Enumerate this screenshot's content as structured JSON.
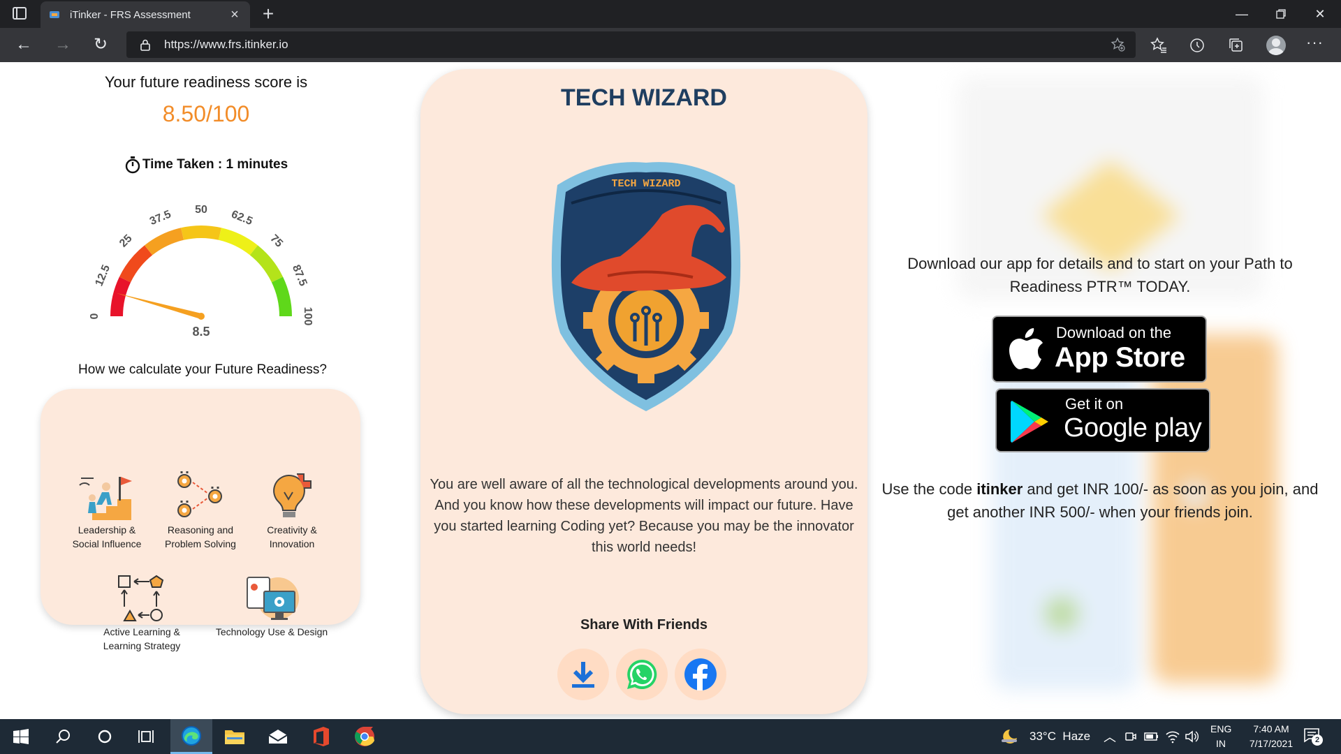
{
  "browser": {
    "tab_title": "iTinker - FRS Assessment",
    "url": "https://www.frs.itinker.io"
  },
  "score": {
    "title": "Your future readiness score is",
    "value": "8.50/100",
    "time_taken": "Time Taken : 1 minutes",
    "gauge_value": 8.5,
    "gauge_max": 100,
    "gauge_value_label": "8.5",
    "gauge_ticks": [
      "0",
      "12.5",
      "25",
      "37.5",
      "50",
      "62.5",
      "75",
      "87.5",
      "100"
    ]
  },
  "calc": {
    "title": "How we calculate your Future Readiness?",
    "skills": [
      {
        "label": "Leadership & Social Influence",
        "icon": "leadership-icon"
      },
      {
        "label": "Reasoning and Problem Solving",
        "icon": "gears-icon"
      },
      {
        "label": "Creativity & Innovation",
        "icon": "lightbulb-icon"
      },
      {
        "label": "Active Learning & Learning Strategy",
        "icon": "flowchart-icon"
      },
      {
        "label": "Technology Use & Design",
        "icon": "computer-design-icon"
      }
    ]
  },
  "result": {
    "title": "TECH WIZARD",
    "badge_text": "TECH WIZARD",
    "description": "You are well aware of all the technological developments around you. And you know how these developments will impact our future. Have you started learning Coding yet? Because you may be the innovator this world needs!",
    "share_title": "Share With Friends",
    "share_buttons": [
      "download-icon",
      "whatsapp-icon",
      "facebook-icon"
    ]
  },
  "app": {
    "download_text": "Download our app for details and to start on your Path to Readiness PTR™ TODAY.",
    "appstore_small": "Download on the",
    "appstore_big": "App Store",
    "play_small": "Get it on",
    "play_big": "Google play",
    "code_prefix": "Use the code ",
    "code": "itinker",
    "code_suffix": " and get INR 100/- as soon as you join, and get another INR 500/- when your friends join."
  },
  "taskbar": {
    "weather": "33°C  Haze",
    "lang_top": "ENG",
    "lang_bottom": "IN",
    "time": "7:40 AM",
    "date": "7/17/2021",
    "notifications": "2"
  },
  "colors": {
    "score": "#f28c28",
    "title_navy": "#1f3e60",
    "card_bg": "#fde9dc"
  }
}
